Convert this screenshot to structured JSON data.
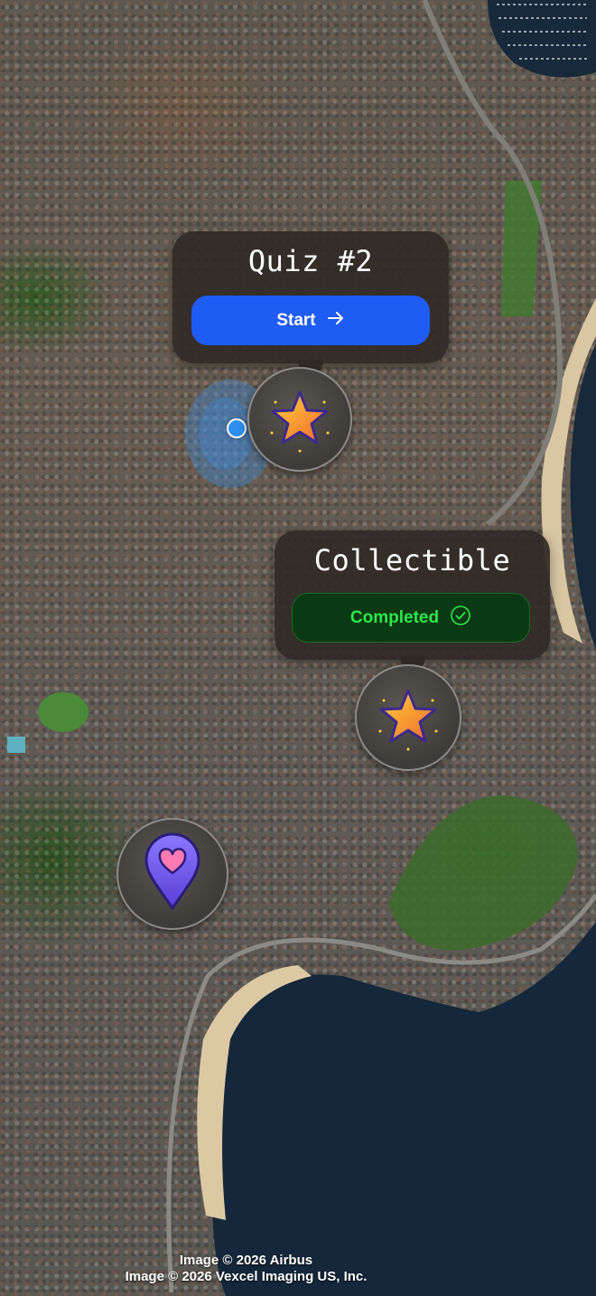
{
  "map": {
    "type": "satellite"
  },
  "markers": [
    {
      "kind": "quiz",
      "title": "Quiz #2",
      "action_label": "Start",
      "action_icon": "arrow-right-icon",
      "marker_icon": "star-icon",
      "accent": "#1f5cf4"
    },
    {
      "kind": "collectible",
      "title": "Collectible",
      "action_label": "Completed",
      "action_icon": "check-circle-icon",
      "marker_icon": "star-icon",
      "accent": "#2ee84a"
    },
    {
      "kind": "favorite",
      "marker_icon": "heart-pin-icon",
      "accent": "#7a5cf0"
    }
  ],
  "user_location": {
    "icon": "user-location-dot",
    "color": "#2f8ff0"
  },
  "attribution": {
    "line1": "Image © 2026 Airbus",
    "line2": "Image © 2026 Vexcel Imaging US, Inc."
  }
}
